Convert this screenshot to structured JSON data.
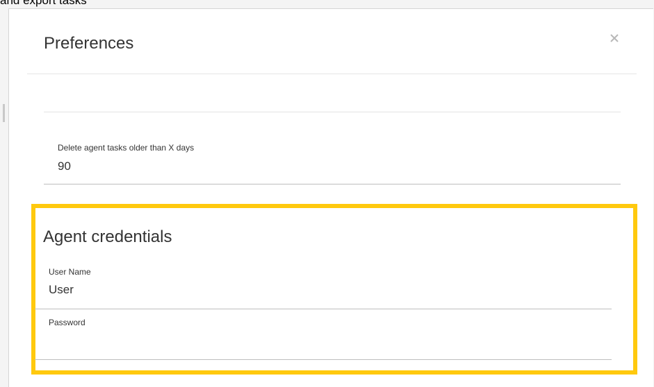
{
  "background": {
    "caption": "and export tasks"
  },
  "dialog": {
    "title": "Preferences",
    "close_icon": "close-icon",
    "delete_tasks_field": {
      "label": "Delete agent tasks older than X days",
      "value": "90"
    },
    "credentials_section": {
      "title": "Agent credentials",
      "username_field": {
        "label": "User Name",
        "value": "User"
      },
      "password_field": {
        "label": "Password",
        "value": ""
      }
    }
  },
  "colors": {
    "highlight": "#ffc90e",
    "text": "#333333",
    "divider": "#bdbdbd"
  }
}
